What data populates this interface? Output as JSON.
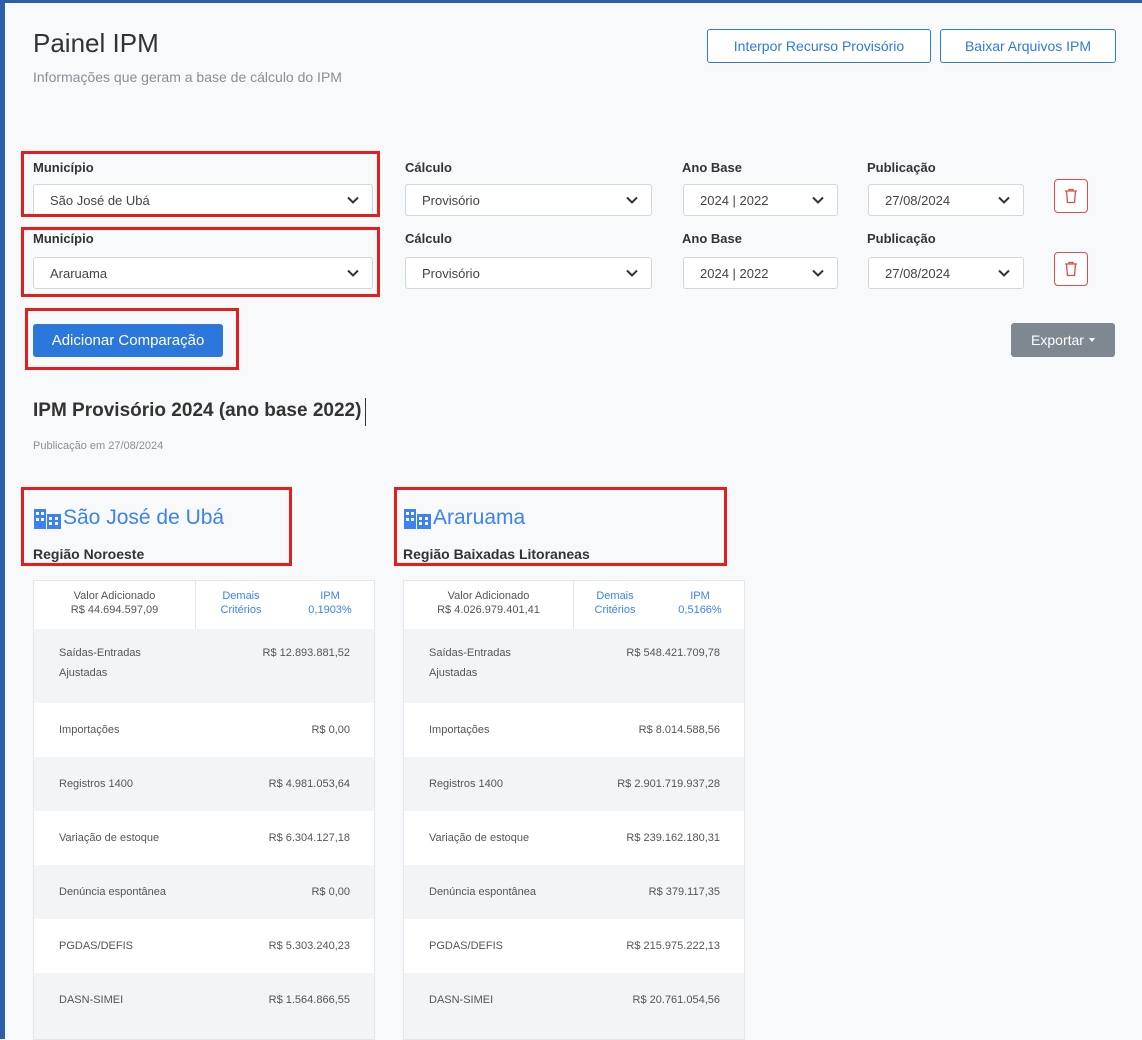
{
  "header": {
    "title": "Painel IPM",
    "subtitle": "Informações que geram a base de cálculo do IPM",
    "btn_recurso": "Interpor Recurso Provisório",
    "btn_baixar": "Baixar Arquivos IPM"
  },
  "labels": {
    "municipio": "Município",
    "calculo": "Cálculo",
    "ano_base": "Ano Base",
    "publicacao": "Publicação"
  },
  "filters": [
    {
      "municipio": "São José de Ubá",
      "calculo": "Provisório",
      "ano_base": "2024 | 2022",
      "publicacao": "27/08/2024"
    },
    {
      "municipio": "Araruama",
      "calculo": "Provisório",
      "ano_base": "2024 | 2022",
      "publicacao": "27/08/2024"
    }
  ],
  "actions": {
    "add_compare": "Adicionar Comparação",
    "export": "Exportar"
  },
  "section": {
    "title": "IPM Provisório 2024 (ano base 2022)",
    "pub": "Publicação em 27/08/2024"
  },
  "cards": [
    {
      "city": "São José de Ubá",
      "region": "Região Noroeste",
      "tab_valor_label": "Valor Adicionado",
      "tab_valor_value": "R$ 44.694.597,09",
      "tab_demais_1": "Demais",
      "tab_demais_2": "Critérios",
      "tab_ipm_label": "IPM",
      "tab_ipm_value": "0,1903%",
      "rows": [
        {
          "label1": "Saídas-Entradas",
          "label2": "Ajustadas",
          "value": "R$ 12.893.881,52"
        },
        {
          "label1": "Importações",
          "value": "R$ 0,00"
        },
        {
          "label1": "Registros 1400",
          "value": "R$ 4.981.053,64"
        },
        {
          "label1": "Variação de estoque",
          "value": "R$ 6.304.127,18"
        },
        {
          "label1": "Denúncia espontânea",
          "value": "R$ 0,00"
        },
        {
          "label1": "PGDAS/DEFIS",
          "value": "R$ 5.303.240,23"
        },
        {
          "label1": "DASN-SIMEI",
          "value": "R$ 1.564.866,55"
        }
      ]
    },
    {
      "city": "Araruama",
      "region": "Região Baixadas Litoraneas",
      "tab_valor_label": "Valor Adicionado",
      "tab_valor_value": "R$ 4.026.979.401,41",
      "tab_demais_1": "Demais",
      "tab_demais_2": "Critérios",
      "tab_ipm_label": "IPM",
      "tab_ipm_value": "0,5166%",
      "rows": [
        {
          "label1": "Saídas-Entradas",
          "label2": "Ajustadas",
          "value": "R$ 548.421.709,78"
        },
        {
          "label1": "Importações",
          "value": "R$ 8.014.588,56"
        },
        {
          "label1": "Registros 1400",
          "value": "R$ 2.901.719.937,28"
        },
        {
          "label1": "Variação de estoque",
          "value": "R$ 239.162.180,31"
        },
        {
          "label1": "Denúncia espontânea",
          "value": "R$ 379.117,35"
        },
        {
          "label1": "PGDAS/DEFIS",
          "value": "R$ 215.975.222,13"
        },
        {
          "label1": "DASN-SIMEI",
          "value": "R$ 20.761.054,56"
        }
      ]
    }
  ],
  "colors": {
    "accent": "#2b77dc",
    "link": "#3b82f6",
    "highlight": "#e41d1d",
    "export_button": "#7f8891"
  },
  "icons": {
    "city": "building-icon",
    "dropdown": "chevron-down-icon",
    "remove": "trash-icon",
    "export": "caret-down-icon"
  }
}
